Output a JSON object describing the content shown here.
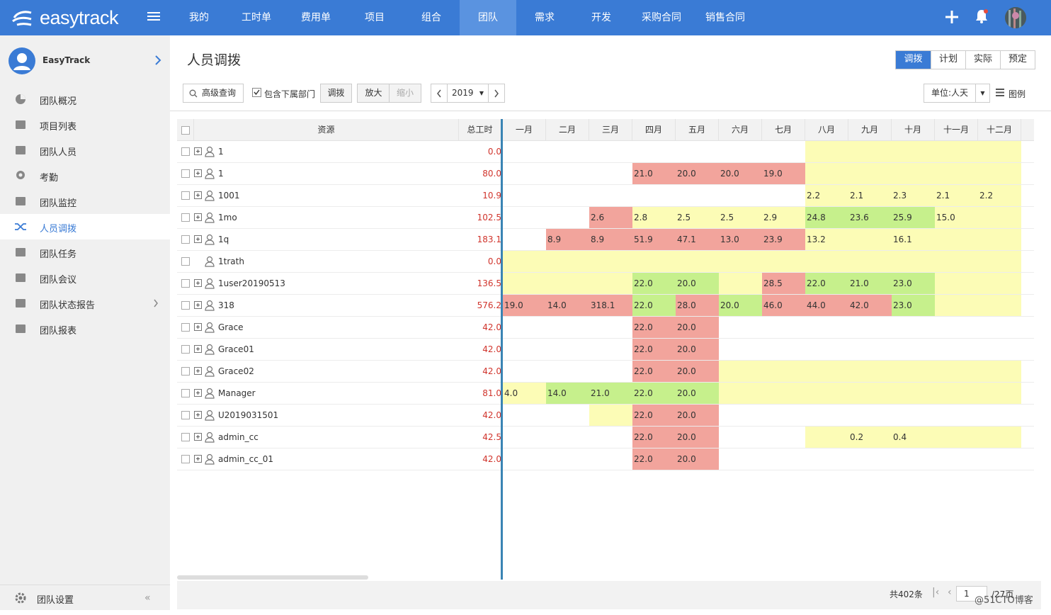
{
  "brand": {
    "name": "easytrack"
  },
  "nav": [
    "我的",
    "工时单",
    "费用单",
    "项目",
    "组合",
    "团队",
    "需求",
    "开发",
    "采购合同",
    "销售合同"
  ],
  "nav_active": 5,
  "sidebar": {
    "user": "EasyTrack",
    "items": [
      "团队概况",
      "项目列表",
      "团队人员",
      "考勤",
      "团队监控",
      "人员调拨",
      "团队任务",
      "团队会议",
      "团队状态报告",
      "团队报表"
    ],
    "active": 5,
    "footer": "团队设置"
  },
  "page": {
    "title": "人员调拨",
    "view_tabs": [
      "调拨",
      "计划",
      "实际",
      "预定"
    ],
    "view_active": 0
  },
  "toolbar": {
    "search": "高级查询",
    "include_sub": "包含下属部门",
    "allocate": "调拨",
    "zoom_in": "放大",
    "zoom_out": "缩小",
    "year": "2019",
    "unit": "单位:人天",
    "legend": "图例"
  },
  "table": {
    "col_resource": "资源",
    "col_total": "总工时",
    "months": [
      "一月",
      "二月",
      "三月",
      "四月",
      "五月",
      "六月",
      "七月",
      "八月",
      "九月",
      "十月",
      "十一月",
      "十二月"
    ],
    "rows": [
      {
        "name": "1",
        "total": "0.0",
        "cells": [
          [
            "",
            ""
          ],
          [
            "",
            ""
          ],
          [
            "",
            ""
          ],
          [
            "",
            ""
          ],
          [
            "",
            ""
          ],
          [
            "",
            ""
          ],
          [
            "",
            ""
          ],
          [
            "",
            "y"
          ],
          [
            "",
            "y"
          ],
          [
            "",
            "y"
          ],
          [
            "",
            "y"
          ],
          [
            "",
            "y"
          ]
        ]
      },
      {
        "name": "1",
        "total": "80.0",
        "cells": [
          [
            "",
            ""
          ],
          [
            "",
            ""
          ],
          [
            "",
            ""
          ],
          [
            "21.0",
            "r"
          ],
          [
            "20.0",
            "r"
          ],
          [
            "20.0",
            "r"
          ],
          [
            "19.0",
            "r"
          ],
          [
            "",
            "y"
          ],
          [
            "",
            "y"
          ],
          [
            "",
            "y"
          ],
          [
            "",
            "y"
          ],
          [
            "",
            "y"
          ]
        ]
      },
      {
        "name": "1001",
        "total": "10.9",
        "cells": [
          [
            "",
            ""
          ],
          [
            "",
            ""
          ],
          [
            "",
            ""
          ],
          [
            "",
            ""
          ],
          [
            "",
            ""
          ],
          [
            "",
            ""
          ],
          [
            "",
            ""
          ],
          [
            "2.2",
            "y"
          ],
          [
            "2.1",
            "y"
          ],
          [
            "2.3",
            "y"
          ],
          [
            "2.1",
            "y"
          ],
          [
            "2.2",
            "y"
          ]
        ]
      },
      {
        "name": "1mo",
        "total": "102.5",
        "cells": [
          [
            "",
            ""
          ],
          [
            "",
            ""
          ],
          [
            "2.6",
            "r"
          ],
          [
            "2.8",
            "y"
          ],
          [
            "2.5",
            "y"
          ],
          [
            "2.5",
            "y"
          ],
          [
            "2.9",
            "y"
          ],
          [
            "24.8",
            "g"
          ],
          [
            "23.6",
            "g"
          ],
          [
            "25.9",
            "g"
          ],
          [
            "15.0",
            "y"
          ],
          [
            "",
            "y"
          ]
        ]
      },
      {
        "name": "1q",
        "total": "183.1",
        "cells": [
          [
            "",
            ""
          ],
          [
            "8.9",
            "r"
          ],
          [
            "8.9",
            "r"
          ],
          [
            "51.9",
            "r"
          ],
          [
            "47.1",
            "r"
          ],
          [
            "13.0",
            "r"
          ],
          [
            "23.9",
            "r"
          ],
          [
            "13.2",
            "y"
          ],
          [
            "",
            "y"
          ],
          [
            "16.1",
            "y"
          ],
          [
            "",
            "y"
          ],
          [
            "",
            "y"
          ]
        ]
      },
      {
        "name": "1trath",
        "total": "0.0",
        "noexpand": true,
        "cells": [
          [
            "",
            "y"
          ],
          [
            "",
            "y"
          ],
          [
            "",
            "y"
          ],
          [
            "",
            "y"
          ],
          [
            "",
            "y"
          ],
          [
            "",
            "y"
          ],
          [
            "",
            "y"
          ],
          [
            "",
            "y"
          ],
          [
            "",
            "y"
          ],
          [
            "",
            "y"
          ],
          [
            "",
            "y"
          ],
          [
            "",
            "y"
          ]
        ]
      },
      {
        "name": "1user20190513",
        "total": "136.5",
        "cells": [
          [
            "",
            "y"
          ],
          [
            "",
            "y"
          ],
          [
            "",
            "y"
          ],
          [
            "22.0",
            "g"
          ],
          [
            "20.0",
            "g"
          ],
          [
            "",
            "y"
          ],
          [
            "28.5",
            "r"
          ],
          [
            "22.0",
            "g"
          ],
          [
            "21.0",
            "g"
          ],
          [
            "23.0",
            "g"
          ],
          [
            "",
            "y"
          ],
          [
            "",
            "y"
          ]
        ]
      },
      {
        "name": "318",
        "total": "576.2",
        "cells": [
          [
            "19.0",
            "r"
          ],
          [
            "14.0",
            "r"
          ],
          [
            "318.1",
            "r"
          ],
          [
            "22.0",
            "g"
          ],
          [
            "28.0",
            "r"
          ],
          [
            "20.0",
            "g"
          ],
          [
            "46.0",
            "r"
          ],
          [
            "44.0",
            "r"
          ],
          [
            "42.0",
            "r"
          ],
          [
            "23.0",
            "g"
          ],
          [
            "",
            "y"
          ],
          [
            "",
            "y"
          ]
        ]
      },
      {
        "name": "Grace",
        "total": "42.0",
        "cells": [
          [
            "",
            ""
          ],
          [
            "",
            ""
          ],
          [
            "",
            ""
          ],
          [
            "22.0",
            "r"
          ],
          [
            "20.0",
            "r"
          ],
          [
            "",
            ""
          ],
          [
            "",
            ""
          ],
          [
            "",
            ""
          ],
          [
            "",
            ""
          ],
          [
            "",
            ""
          ],
          [
            "",
            ""
          ],
          [
            "",
            ""
          ]
        ]
      },
      {
        "name": "Grace01",
        "total": "42.0",
        "cells": [
          [
            "",
            ""
          ],
          [
            "",
            ""
          ],
          [
            "",
            ""
          ],
          [
            "22.0",
            "r"
          ],
          [
            "20.0",
            "r"
          ],
          [
            "",
            ""
          ],
          [
            "",
            ""
          ],
          [
            "",
            ""
          ],
          [
            "",
            ""
          ],
          [
            "",
            ""
          ],
          [
            "",
            ""
          ],
          [
            "",
            ""
          ]
        ]
      },
      {
        "name": "Grace02",
        "total": "42.0",
        "cells": [
          [
            "",
            ""
          ],
          [
            "",
            ""
          ],
          [
            "",
            ""
          ],
          [
            "22.0",
            "r"
          ],
          [
            "20.0",
            "r"
          ],
          [
            "",
            "y"
          ],
          [
            "",
            "y"
          ],
          [
            "",
            "y"
          ],
          [
            "",
            "y"
          ],
          [
            "",
            "y"
          ],
          [
            "",
            "y"
          ],
          [
            "",
            "y"
          ]
        ]
      },
      {
        "name": "Manager",
        "total": "81.0",
        "cells": [
          [
            "4.0",
            "y"
          ],
          [
            "14.0",
            "g"
          ],
          [
            "21.0",
            "g"
          ],
          [
            "22.0",
            "g"
          ],
          [
            "20.0",
            "g"
          ],
          [
            "",
            "y"
          ],
          [
            "",
            "y"
          ],
          [
            "",
            "y"
          ],
          [
            "",
            "y"
          ],
          [
            "",
            "y"
          ],
          [
            "",
            "y"
          ],
          [
            "",
            "y"
          ]
        ]
      },
      {
        "name": "U2019031501",
        "total": "42.0",
        "cells": [
          [
            "",
            ""
          ],
          [
            "",
            ""
          ],
          [
            "",
            "y"
          ],
          [
            "22.0",
            "r"
          ],
          [
            "20.0",
            "r"
          ],
          [
            "",
            ""
          ],
          [
            "",
            ""
          ],
          [
            "",
            ""
          ],
          [
            "",
            ""
          ],
          [
            "",
            ""
          ],
          [
            "",
            ""
          ],
          [
            "",
            ""
          ]
        ]
      },
      {
        "name": "admin_cc",
        "total": "42.5",
        "cells": [
          [
            "",
            ""
          ],
          [
            "",
            ""
          ],
          [
            "",
            ""
          ],
          [
            "22.0",
            "r"
          ],
          [
            "20.0",
            "r"
          ],
          [
            "",
            ""
          ],
          [
            "",
            ""
          ],
          [
            "",
            "y"
          ],
          [
            "0.2",
            "y"
          ],
          [
            "0.4",
            "y"
          ],
          [
            "",
            "y"
          ],
          [
            "",
            "y"
          ]
        ]
      },
      {
        "name": "admin_cc_01",
        "total": "42.0",
        "cells": [
          [
            "",
            ""
          ],
          [
            "",
            ""
          ],
          [
            "",
            ""
          ],
          [
            "22.0",
            "r"
          ],
          [
            "20.0",
            "r"
          ],
          [
            "",
            ""
          ],
          [
            "",
            ""
          ],
          [
            "",
            ""
          ],
          [
            "",
            ""
          ],
          [
            "",
            ""
          ],
          [
            "",
            ""
          ],
          [
            "",
            ""
          ]
        ]
      }
    ]
  },
  "footer": {
    "count": "共402条",
    "page": "1",
    "total_pages": "/27页"
  },
  "watermark": "@51CTO博客"
}
